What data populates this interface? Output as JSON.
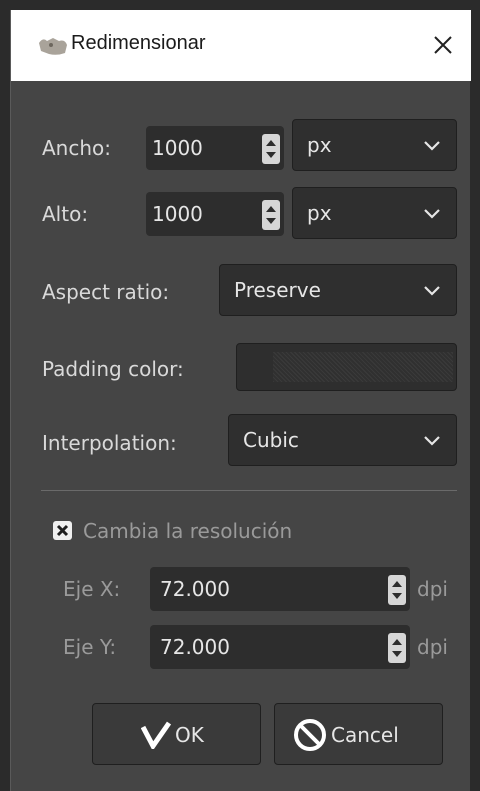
{
  "window": {
    "title": "Redimensionar"
  },
  "width": {
    "label": "Ancho:",
    "value": "1000",
    "unit": "px"
  },
  "height": {
    "label": "Alto:",
    "value": "1000",
    "unit": "px"
  },
  "aspect": {
    "label": "Aspect ratio:",
    "value": "Preserve"
  },
  "padding": {
    "label": "Padding color:"
  },
  "interp": {
    "label": "Interpolation:",
    "value": "Cubic"
  },
  "resolution": {
    "checkbox_label": "Cambia la resolución",
    "checked": true,
    "x": {
      "label": "Eje X:",
      "value": "72.000",
      "unit": "dpi"
    },
    "y": {
      "label": "Eje Y:",
      "value": "72.000",
      "unit": "dpi"
    }
  },
  "buttons": {
    "ok": "OK",
    "cancel": "Cancel"
  },
  "icons": [
    "gimp-app-icon",
    "close-icon",
    "spin-arrows-icon",
    "chevron-down-icon",
    "checkmark-icon",
    "cancel-circle-icon"
  ]
}
